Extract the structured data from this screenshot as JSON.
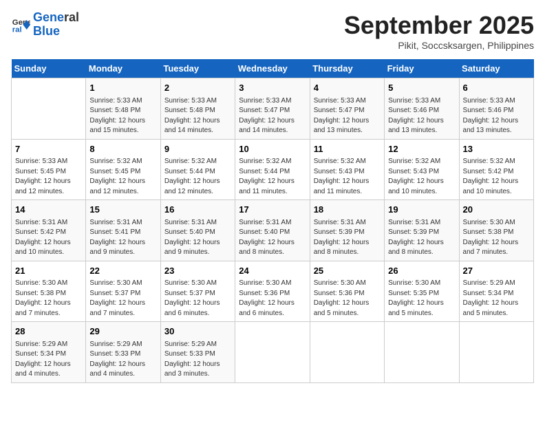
{
  "logo": {
    "line1": "General",
    "line2": "Blue"
  },
  "title": "September 2025",
  "location": "Pikit, Soccsksargen, Philippines",
  "days_of_week": [
    "Sunday",
    "Monday",
    "Tuesday",
    "Wednesday",
    "Thursday",
    "Friday",
    "Saturday"
  ],
  "weeks": [
    [
      {
        "day": "",
        "info": ""
      },
      {
        "day": "1",
        "info": "Sunrise: 5:33 AM\nSunset: 5:48 PM\nDaylight: 12 hours\nand 15 minutes."
      },
      {
        "day": "2",
        "info": "Sunrise: 5:33 AM\nSunset: 5:48 PM\nDaylight: 12 hours\nand 14 minutes."
      },
      {
        "day": "3",
        "info": "Sunrise: 5:33 AM\nSunset: 5:47 PM\nDaylight: 12 hours\nand 14 minutes."
      },
      {
        "day": "4",
        "info": "Sunrise: 5:33 AM\nSunset: 5:47 PM\nDaylight: 12 hours\nand 13 minutes."
      },
      {
        "day": "5",
        "info": "Sunrise: 5:33 AM\nSunset: 5:46 PM\nDaylight: 12 hours\nand 13 minutes."
      },
      {
        "day": "6",
        "info": "Sunrise: 5:33 AM\nSunset: 5:46 PM\nDaylight: 12 hours\nand 13 minutes."
      }
    ],
    [
      {
        "day": "7",
        "info": "Sunrise: 5:33 AM\nSunset: 5:45 PM\nDaylight: 12 hours\nand 12 minutes."
      },
      {
        "day": "8",
        "info": "Sunrise: 5:32 AM\nSunset: 5:45 PM\nDaylight: 12 hours\nand 12 minutes."
      },
      {
        "day": "9",
        "info": "Sunrise: 5:32 AM\nSunset: 5:44 PM\nDaylight: 12 hours\nand 12 minutes."
      },
      {
        "day": "10",
        "info": "Sunrise: 5:32 AM\nSunset: 5:44 PM\nDaylight: 12 hours\nand 11 minutes."
      },
      {
        "day": "11",
        "info": "Sunrise: 5:32 AM\nSunset: 5:43 PM\nDaylight: 12 hours\nand 11 minutes."
      },
      {
        "day": "12",
        "info": "Sunrise: 5:32 AM\nSunset: 5:43 PM\nDaylight: 12 hours\nand 10 minutes."
      },
      {
        "day": "13",
        "info": "Sunrise: 5:32 AM\nSunset: 5:42 PM\nDaylight: 12 hours\nand 10 minutes."
      }
    ],
    [
      {
        "day": "14",
        "info": "Sunrise: 5:31 AM\nSunset: 5:42 PM\nDaylight: 12 hours\nand 10 minutes."
      },
      {
        "day": "15",
        "info": "Sunrise: 5:31 AM\nSunset: 5:41 PM\nDaylight: 12 hours\nand 9 minutes."
      },
      {
        "day": "16",
        "info": "Sunrise: 5:31 AM\nSunset: 5:40 PM\nDaylight: 12 hours\nand 9 minutes."
      },
      {
        "day": "17",
        "info": "Sunrise: 5:31 AM\nSunset: 5:40 PM\nDaylight: 12 hours\nand 8 minutes."
      },
      {
        "day": "18",
        "info": "Sunrise: 5:31 AM\nSunset: 5:39 PM\nDaylight: 12 hours\nand 8 minutes."
      },
      {
        "day": "19",
        "info": "Sunrise: 5:31 AM\nSunset: 5:39 PM\nDaylight: 12 hours\nand 8 minutes."
      },
      {
        "day": "20",
        "info": "Sunrise: 5:30 AM\nSunset: 5:38 PM\nDaylight: 12 hours\nand 7 minutes."
      }
    ],
    [
      {
        "day": "21",
        "info": "Sunrise: 5:30 AM\nSunset: 5:38 PM\nDaylight: 12 hours\nand 7 minutes."
      },
      {
        "day": "22",
        "info": "Sunrise: 5:30 AM\nSunset: 5:37 PM\nDaylight: 12 hours\nand 7 minutes."
      },
      {
        "day": "23",
        "info": "Sunrise: 5:30 AM\nSunset: 5:37 PM\nDaylight: 12 hours\nand 6 minutes."
      },
      {
        "day": "24",
        "info": "Sunrise: 5:30 AM\nSunset: 5:36 PM\nDaylight: 12 hours\nand 6 minutes."
      },
      {
        "day": "25",
        "info": "Sunrise: 5:30 AM\nSunset: 5:36 PM\nDaylight: 12 hours\nand 5 minutes."
      },
      {
        "day": "26",
        "info": "Sunrise: 5:30 AM\nSunset: 5:35 PM\nDaylight: 12 hours\nand 5 minutes."
      },
      {
        "day": "27",
        "info": "Sunrise: 5:29 AM\nSunset: 5:34 PM\nDaylight: 12 hours\nand 5 minutes."
      }
    ],
    [
      {
        "day": "28",
        "info": "Sunrise: 5:29 AM\nSunset: 5:34 PM\nDaylight: 12 hours\nand 4 minutes."
      },
      {
        "day": "29",
        "info": "Sunrise: 5:29 AM\nSunset: 5:33 PM\nDaylight: 12 hours\nand 4 minutes."
      },
      {
        "day": "30",
        "info": "Sunrise: 5:29 AM\nSunset: 5:33 PM\nDaylight: 12 hours\nand 3 minutes."
      },
      {
        "day": "",
        "info": ""
      },
      {
        "day": "",
        "info": ""
      },
      {
        "day": "",
        "info": ""
      },
      {
        "day": "",
        "info": ""
      }
    ]
  ]
}
